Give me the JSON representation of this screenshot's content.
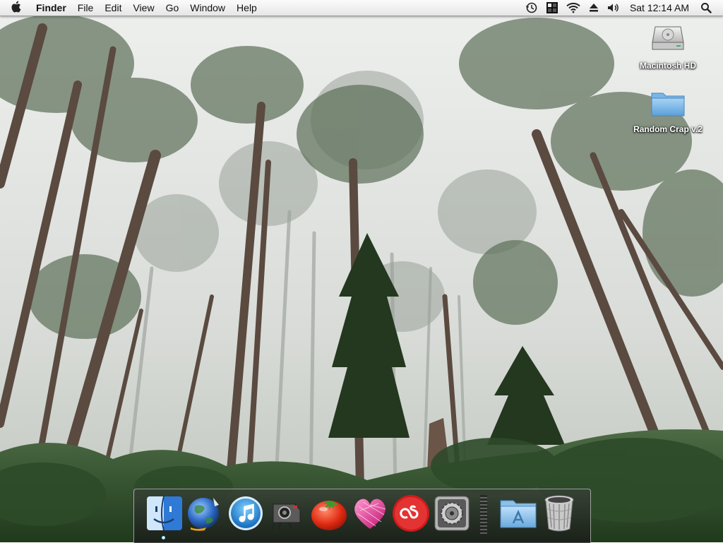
{
  "menubar": {
    "app_name": "Finder",
    "items": [
      "File",
      "Edit",
      "View",
      "Go",
      "Window",
      "Help"
    ],
    "clock": "Sat 12:14 AM",
    "status_icons": [
      "time-machine-icon",
      "spaces-icon",
      "wifi-icon",
      "eject-icon",
      "volume-icon",
      "spotlight-icon"
    ]
  },
  "desktop": {
    "icons": [
      {
        "label": "Macintosh HD",
        "icon": "hard-drive-icon"
      },
      {
        "label": "Random Crap v.2",
        "icon": "folder-icon"
      }
    ]
  },
  "dock": {
    "items": [
      {
        "name": "Finder",
        "icon": "finder-icon",
        "running": true
      },
      {
        "name": "Camino",
        "icon": "camino-icon",
        "running": false
      },
      {
        "name": "iTunes",
        "icon": "itunes-icon",
        "running": false
      },
      {
        "name": "Transmit",
        "icon": "transmit-icon",
        "running": false
      },
      {
        "name": "Tomato",
        "icon": "tomato-icon",
        "running": false
      },
      {
        "name": "Growl",
        "icon": "heart-icon",
        "running": false
      },
      {
        "name": "Last.fm",
        "icon": "lastfm-icon",
        "running": false
      },
      {
        "name": "System Preferences",
        "icon": "system-preferences-icon",
        "running": false
      },
      {
        "name": "Applications",
        "icon": "applications-folder-icon",
        "running": false
      },
      {
        "name": "Trash",
        "icon": "trash-icon",
        "running": false
      }
    ]
  },
  "colors": {
    "menubar_top": "#fbfbfb",
    "menubar_bottom": "#e6e6e6",
    "fog": "#e4e6e4",
    "foliage": "#3a5a35"
  }
}
